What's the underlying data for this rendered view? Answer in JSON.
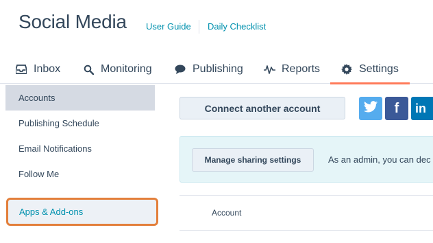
{
  "header": {
    "title": "Social Media",
    "links": {
      "user_guide": "User Guide",
      "daily_checklist": "Daily Checklist"
    }
  },
  "tabs": [
    {
      "label": "Inbox",
      "icon": "inbox-icon"
    },
    {
      "label": "Monitoring",
      "icon": "search-icon"
    },
    {
      "label": "Publishing",
      "icon": "speech-bubble-icon"
    },
    {
      "label": "Reports",
      "icon": "pulse-icon"
    },
    {
      "label": "Settings",
      "icon": "gear-icon",
      "active": true
    }
  ],
  "sidebar": {
    "items": [
      {
        "label": "Accounts",
        "active": true
      },
      {
        "label": "Publishing Schedule"
      },
      {
        "label": "Email Notifications"
      },
      {
        "label": "Follow Me"
      },
      {
        "label": "Apps & Add-ons",
        "highlighted": true
      }
    ]
  },
  "main": {
    "connect_button": "Connect another account",
    "social_buttons": [
      {
        "name": "twitter",
        "icon": "twitter-icon",
        "color": "#55acee"
      },
      {
        "name": "facebook",
        "glyph": "f",
        "color": "#3b5998"
      },
      {
        "name": "linkedin",
        "glyph": "in",
        "color": "#0077b5"
      }
    ],
    "notice": {
      "button": "Manage sharing settings",
      "text": "As an admin, you can dec"
    },
    "table": {
      "columns": [
        "Account"
      ]
    }
  },
  "colors": {
    "accent": "#ff7a59",
    "highlight_border": "#e37f3b",
    "link": "#0091ae"
  }
}
